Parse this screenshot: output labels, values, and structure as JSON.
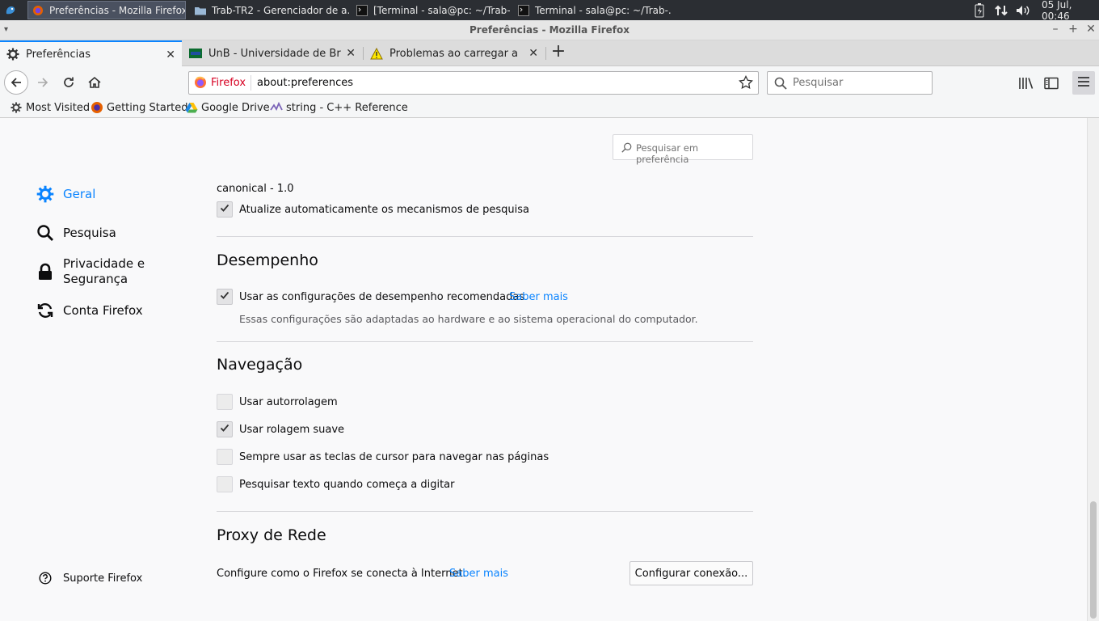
{
  "taskbar": {
    "tasks": [
      {
        "label": "Preferências - Mozilla Firefox"
      },
      {
        "label": "Trab-TR2 - Gerenciador de a..."
      },
      {
        "label": "[Terminal - sala@pc: ~/Trab-..."
      },
      {
        "label": "Terminal - sala@pc: ~/Trab-..."
      }
    ],
    "clock": "05 Jul, 00:46"
  },
  "window": {
    "title": "Preferências - Mozilla Firefox"
  },
  "tabs": [
    {
      "label": "Preferências"
    },
    {
      "label": "UnB - Universidade de Brasília"
    },
    {
      "label": "Problemas ao carregar a página"
    }
  ],
  "urlbar": {
    "identity": "Firefox",
    "url": "about:preferences"
  },
  "searchbar": {
    "placeholder": "Pesquisar"
  },
  "bookmarks": [
    {
      "label": "Most Visited"
    },
    {
      "label": "Getting Started"
    },
    {
      "label": "Google Drive"
    },
    {
      "label": "string - C++ Reference"
    }
  ],
  "sidebar": {
    "categories": [
      {
        "label": "Geral"
      },
      {
        "label": "Pesquisa"
      },
      {
        "label": "Privacidade e Segurança"
      },
      {
        "label": "Conta Firefox"
      }
    ],
    "support": "Suporte Firefox"
  },
  "pref_search": {
    "placeholder": "Pesquisar em preferência"
  },
  "content": {
    "canonical": "canonical - 1.0",
    "auto_update": {
      "label": "Atualize automaticamente os mecanismos de pesquisa",
      "checked": true
    },
    "performance": {
      "heading": "Desempenho",
      "recommended": {
        "label": "Usar as configurações de desempenho recomendadas",
        "checked": true
      },
      "learn_more": "Saber mais",
      "note": "Essas configurações são adaptadas ao hardware e ao sistema operacional do computador."
    },
    "navigation": {
      "heading": "Navegação",
      "options": [
        {
          "label": "Usar autorrolagem",
          "checked": false
        },
        {
          "label": "Usar rolagem suave",
          "checked": true
        },
        {
          "label": "Sempre usar as teclas de cursor para navegar nas páginas",
          "checked": false
        },
        {
          "label": "Pesquisar texto quando começa a digitar",
          "checked": false
        }
      ]
    },
    "proxy": {
      "heading": "Proxy de Rede",
      "description": "Configure como o Firefox se conecta à Internet.",
      "learn_more": "Saber mais",
      "button": "Configurar conexão..."
    }
  },
  "colors": {
    "accent": "#0a84ff",
    "taskbar": "#2b2e33"
  }
}
